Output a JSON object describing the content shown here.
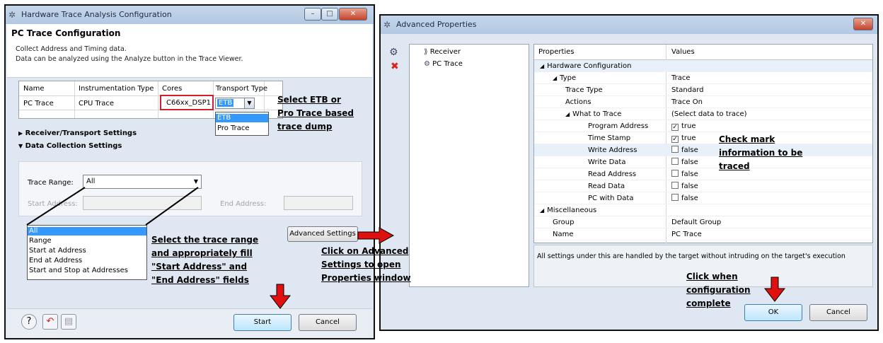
{
  "left_window": {
    "title": "Hardware Trace Analysis Configuration",
    "caption_buttons": [
      "–",
      "□",
      "✕"
    ],
    "heading": "PC Trace Configuration",
    "desc_line1": "Collect Address and Timing data.",
    "desc_line2": "Data can be analyzed using the Analyze button in the Trace Viewer.",
    "table": {
      "headers": [
        "Name",
        "Instrumentation Type",
        "Cores",
        "Transport Type"
      ],
      "row": {
        "name": "PC Trace",
        "type": "CPU Trace",
        "cores": "C66xx_DSP1",
        "transport": "ETB"
      }
    },
    "transport_options": [
      "ETB",
      "Pro Trace"
    ],
    "section_receiver": "Receiver/Transport Settings",
    "section_data": "Data Collection Settings",
    "trace_range_label": "Trace Range:",
    "trace_range_value": "All",
    "start_address_label": "Start Address:",
    "end_address_label": "End Address:",
    "range_options": [
      "All",
      "Range",
      "Start at Address",
      "End at Address",
      "Start and Stop at Addresses"
    ],
    "advanced_button": "Advanced Settings",
    "start_button": "Start",
    "cancel_button": "Cancel"
  },
  "right_window": {
    "title": "Advanced Properties",
    "tree": [
      "Receiver",
      "PC Trace"
    ],
    "grid_headers": [
      "Properties",
      "Values"
    ],
    "rows": [
      {
        "prop": "Hardware Configuration",
        "value": "",
        "level": 0,
        "toggle": "◢",
        "check": null,
        "highlight": true
      },
      {
        "prop": "Type",
        "value": "Trace",
        "level": 1,
        "toggle": "◢",
        "check": null
      },
      {
        "prop": "Trace Type",
        "value": "Standard",
        "level": 2,
        "toggle": "",
        "check": null
      },
      {
        "prop": "Actions",
        "value": "Trace On",
        "level": 2,
        "toggle": "",
        "check": null
      },
      {
        "prop": "What to Trace",
        "value": "(Select data to trace)",
        "level": 2,
        "toggle": "◢",
        "check": null
      },
      {
        "prop": "Program Address",
        "value": "true",
        "level": 3,
        "toggle": "",
        "check": true
      },
      {
        "prop": "Time Stamp",
        "value": "true",
        "level": 3,
        "toggle": "",
        "check": true
      },
      {
        "prop": "Write Address",
        "value": "false",
        "level": 3,
        "toggle": "",
        "check": false,
        "highlight": true
      },
      {
        "prop": "Write Data",
        "value": "false",
        "level": 3,
        "toggle": "",
        "check": false
      },
      {
        "prop": "Read Address",
        "value": "false",
        "level": 3,
        "toggle": "",
        "check": false
      },
      {
        "prop": "Read Data",
        "value": "false",
        "level": 3,
        "toggle": "",
        "check": false
      },
      {
        "prop": "PC with Data",
        "value": "false",
        "level": 3,
        "toggle": "",
        "check": false
      },
      {
        "prop": "Miscellaneous",
        "value": "",
        "level": 0,
        "toggle": "◢",
        "check": null
      },
      {
        "prop": "Group",
        "value": "Default Group",
        "level": 1,
        "toggle": "",
        "check": null
      },
      {
        "prop": "Name",
        "value": "PC Trace",
        "level": 1,
        "toggle": "",
        "check": null
      }
    ],
    "description": "All settings under this are handled by the target without intruding on the target's execution",
    "ok_button": "OK",
    "cancel_button": "Cancel"
  },
  "annotations": {
    "select_etb": [
      "Select ETB or",
      "Pro Trace based",
      "trace dump"
    ],
    "select_range": [
      "Select the trace range",
      "and appropriately fill",
      "\"Start Address\" and",
      "\"End Address\" fields"
    ],
    "click_advanced": [
      "Click on Advanced",
      "Settings to open",
      "Properties window"
    ],
    "check_mark": [
      "Check mark",
      "information to be",
      "traced"
    ],
    "click_when": [
      "Click when",
      "configuration",
      "complete"
    ]
  },
  "colors": {
    "highlight_red": "#d2202a",
    "arrow_red": "#e01010",
    "selection_blue": "#3399ff"
  }
}
